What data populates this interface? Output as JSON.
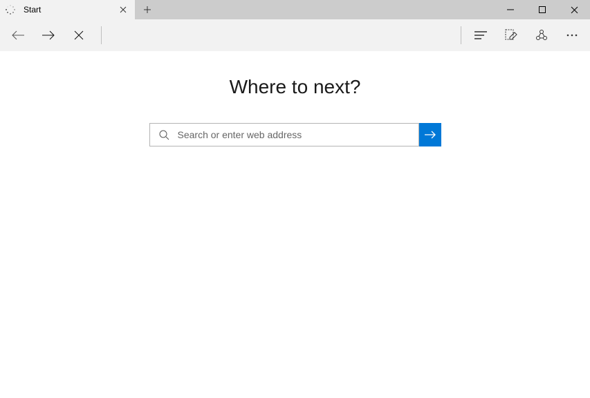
{
  "tab": {
    "title": "Start"
  },
  "content": {
    "heading": "Where to next?",
    "search_placeholder": "Search or enter web address"
  },
  "colors": {
    "accent": "#0078d7"
  }
}
